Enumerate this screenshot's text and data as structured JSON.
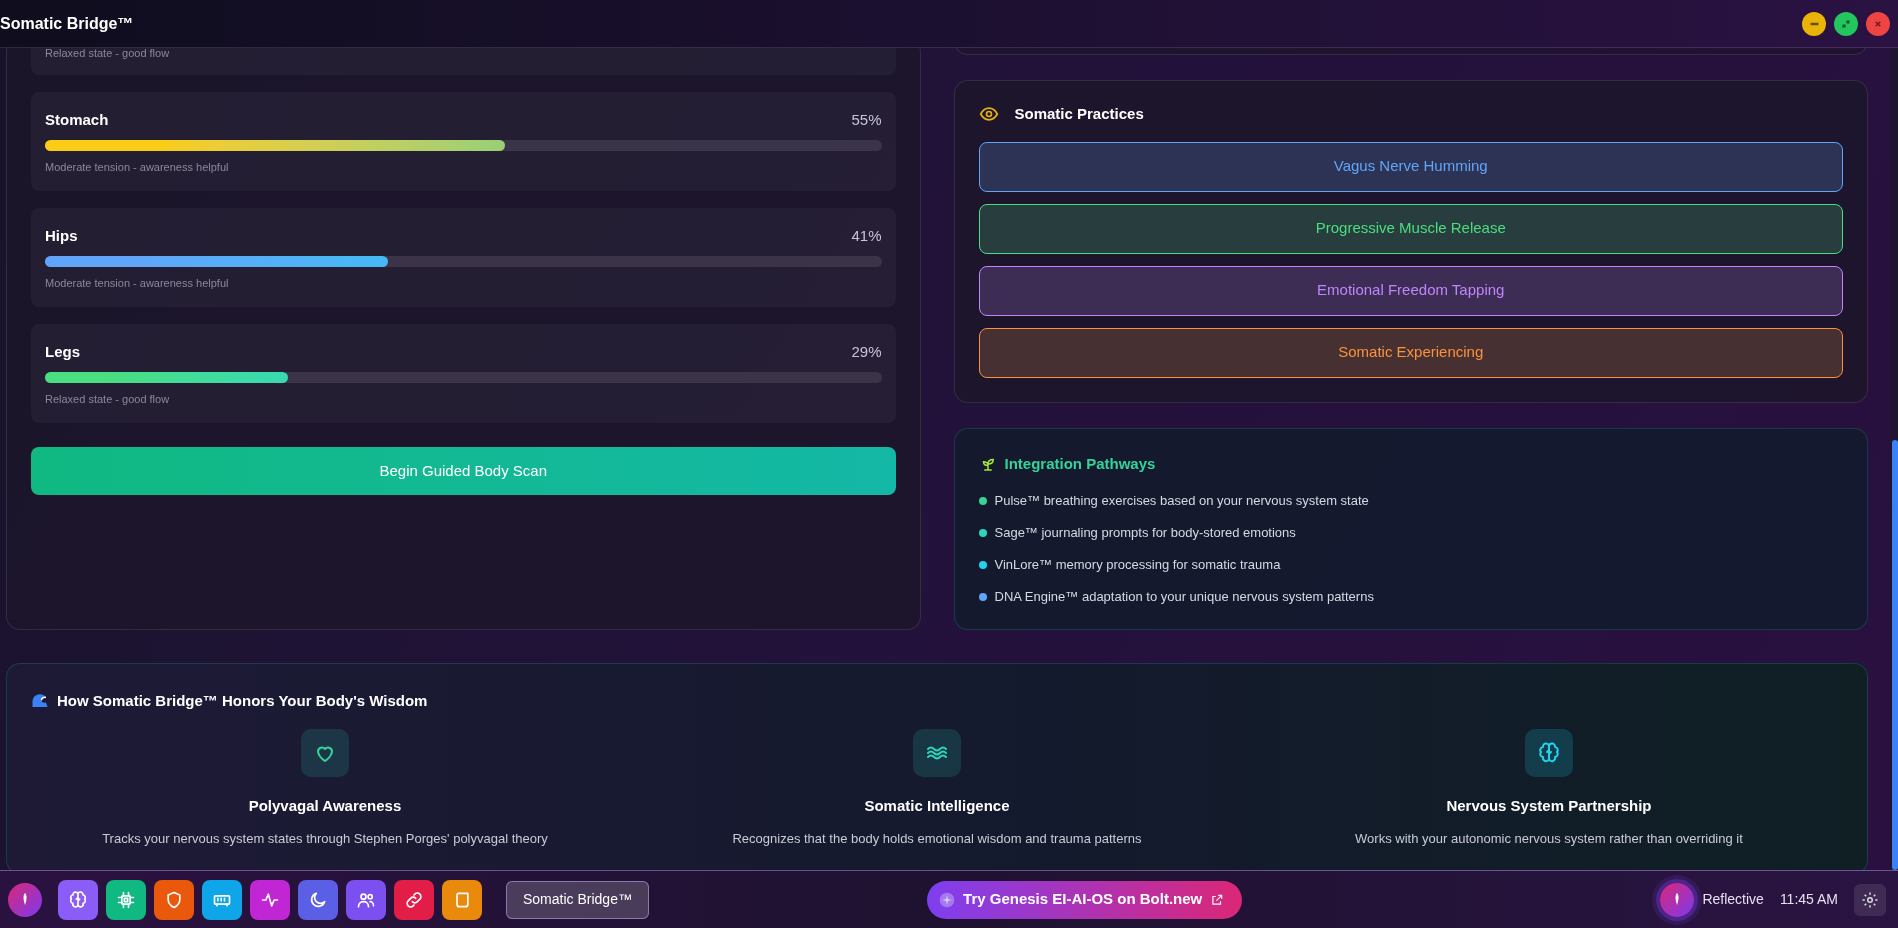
{
  "window": {
    "title": "Somatic Bridge™",
    "controls": [
      {
        "kind": "minimize"
      },
      {
        "kind": "maximize"
      },
      {
        "kind": "close"
      }
    ]
  },
  "body_scan": {
    "partial_note": "Relaxed state - good flow",
    "regions": [
      {
        "name": "Stomach",
        "reading": "55%",
        "level": 0.55,
        "note": "Moderate tension - awareness helpful",
        "color": "#facc15"
      },
      {
        "name": "Hips",
        "reading": "41%",
        "level": 0.41,
        "note": "Moderate tension - awareness helpful",
        "color": "#60a5fa"
      },
      {
        "name": "Legs",
        "reading": "29%",
        "level": 0.29,
        "note": "Relaxed state - good flow",
        "color": "#4ade80"
      }
    ],
    "button": "Begin Guided Body Scan"
  },
  "practices": {
    "title": "Somatic Practices",
    "items": [
      {
        "label": "Vagus Nerve Humming",
        "color": "#60a5fa"
      },
      {
        "label": "Progressive Muscle Release",
        "color": "#4ade80"
      },
      {
        "label": "Emotional Freedom Tapping",
        "color": "#c084fc"
      },
      {
        "label": "Somatic Experiencing",
        "color": "#fb923c"
      }
    ]
  },
  "integration": {
    "title": "Integration Pathways",
    "items": [
      {
        "text": "Pulse™ breathing exercises based on your nervous system state",
        "color": "#34d399"
      },
      {
        "text": "Sage™ journaling prompts for body-stored emotions",
        "color": "#2dd4bf"
      },
      {
        "text": "VinLore™ memory processing for somatic trauma",
        "color": "#22d3ee"
      },
      {
        "text": "DNA Engine™ adaptation to your unique nervous system patterns",
        "color": "#60a5fa"
      }
    ]
  },
  "wisdom": {
    "title": "How Somatic Bridge™ Honors Your Body's Wisdom",
    "items": [
      {
        "kind": "heart",
        "title": "Polyvagal Awareness",
        "text": "Tracks your nervous system states through Stephen Porges' polyvagal theory"
      },
      {
        "kind": "waves",
        "title": "Somatic Intelligence",
        "text": "Recognizes that the body holds emotional wisdom and trauma patterns"
      },
      {
        "kind": "brain",
        "title": "Nervous System Partnership",
        "text": "Works with your autonomic nervous system rather than overriding it"
      }
    ]
  },
  "taskbar": {
    "apps": [
      {
        "kind": "brain",
        "color": "#8b5cf6"
      },
      {
        "kind": "chip",
        "color": "#10b981"
      },
      {
        "kind": "shield",
        "color": "#ea580c"
      },
      {
        "kind": "memory",
        "color": "#0ea5e9"
      },
      {
        "kind": "activity",
        "color": "#c026d3"
      },
      {
        "kind": "moon",
        "color": "#5b5fe6"
      },
      {
        "kind": "users",
        "color": "#7c4ff0"
      },
      {
        "kind": "link",
        "color": "#e11d48"
      },
      {
        "kind": "scroll",
        "color": "#ea8a0c"
      }
    ],
    "windows": [
      {
        "label": "Somatic Bridge™",
        "selected": true
      }
    ],
    "promo": "Try Genesis EI-AI-OS on Bolt.new",
    "mood": "Reflective",
    "clock": "11:45 AM"
  }
}
